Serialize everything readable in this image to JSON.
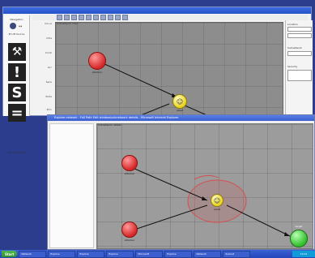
{
  "back_window": {
    "palette": {
      "top_label": "Navigation",
      "section_label": "IE Lift Source",
      "bottom_label": "Administration",
      "icons": [
        "wrench-icon",
        "exclamation-icon",
        "hook-icon",
        "equals-icon"
      ]
    },
    "canvas_tab": "Subnetwork main",
    "ruler_labels": [
      "CC+A",
      "Infra",
      "Contr",
      "Acc",
      "Sens",
      "Ports",
      "Proc"
    ],
    "right_panel": {
      "title": "Location",
      "section2": "Subnetwork",
      "section3": "Security"
    },
    "nodes": {
      "red_node_label": "attacker",
      "yellow_node_label": "asset"
    }
  },
  "front_window": {
    "title": "Explore network - Full Path Edit window/subnetwork details - Microsoft Internet Explorer",
    "canvas_tab": "Subnetwork details",
    "nodes": {
      "yellow_node_label": "asset",
      "red_node_labels": [
        "attacker",
        "attacker"
      ],
      "green_node_label": "target"
    }
  },
  "taskbar": {
    "start_label": "Start",
    "items": [
      "Network",
      "Explore",
      "Explore",
      "Explore",
      "Microsoft",
      "Explore",
      "Network",
      "Subnet"
    ],
    "clock": "10:12"
  },
  "colors": {
    "desktop": "#2b3d8c",
    "node_red": "#d62727",
    "node_yellow": "#e9d41e",
    "node_green": "#2fbf2a",
    "selection": "#d65050"
  }
}
